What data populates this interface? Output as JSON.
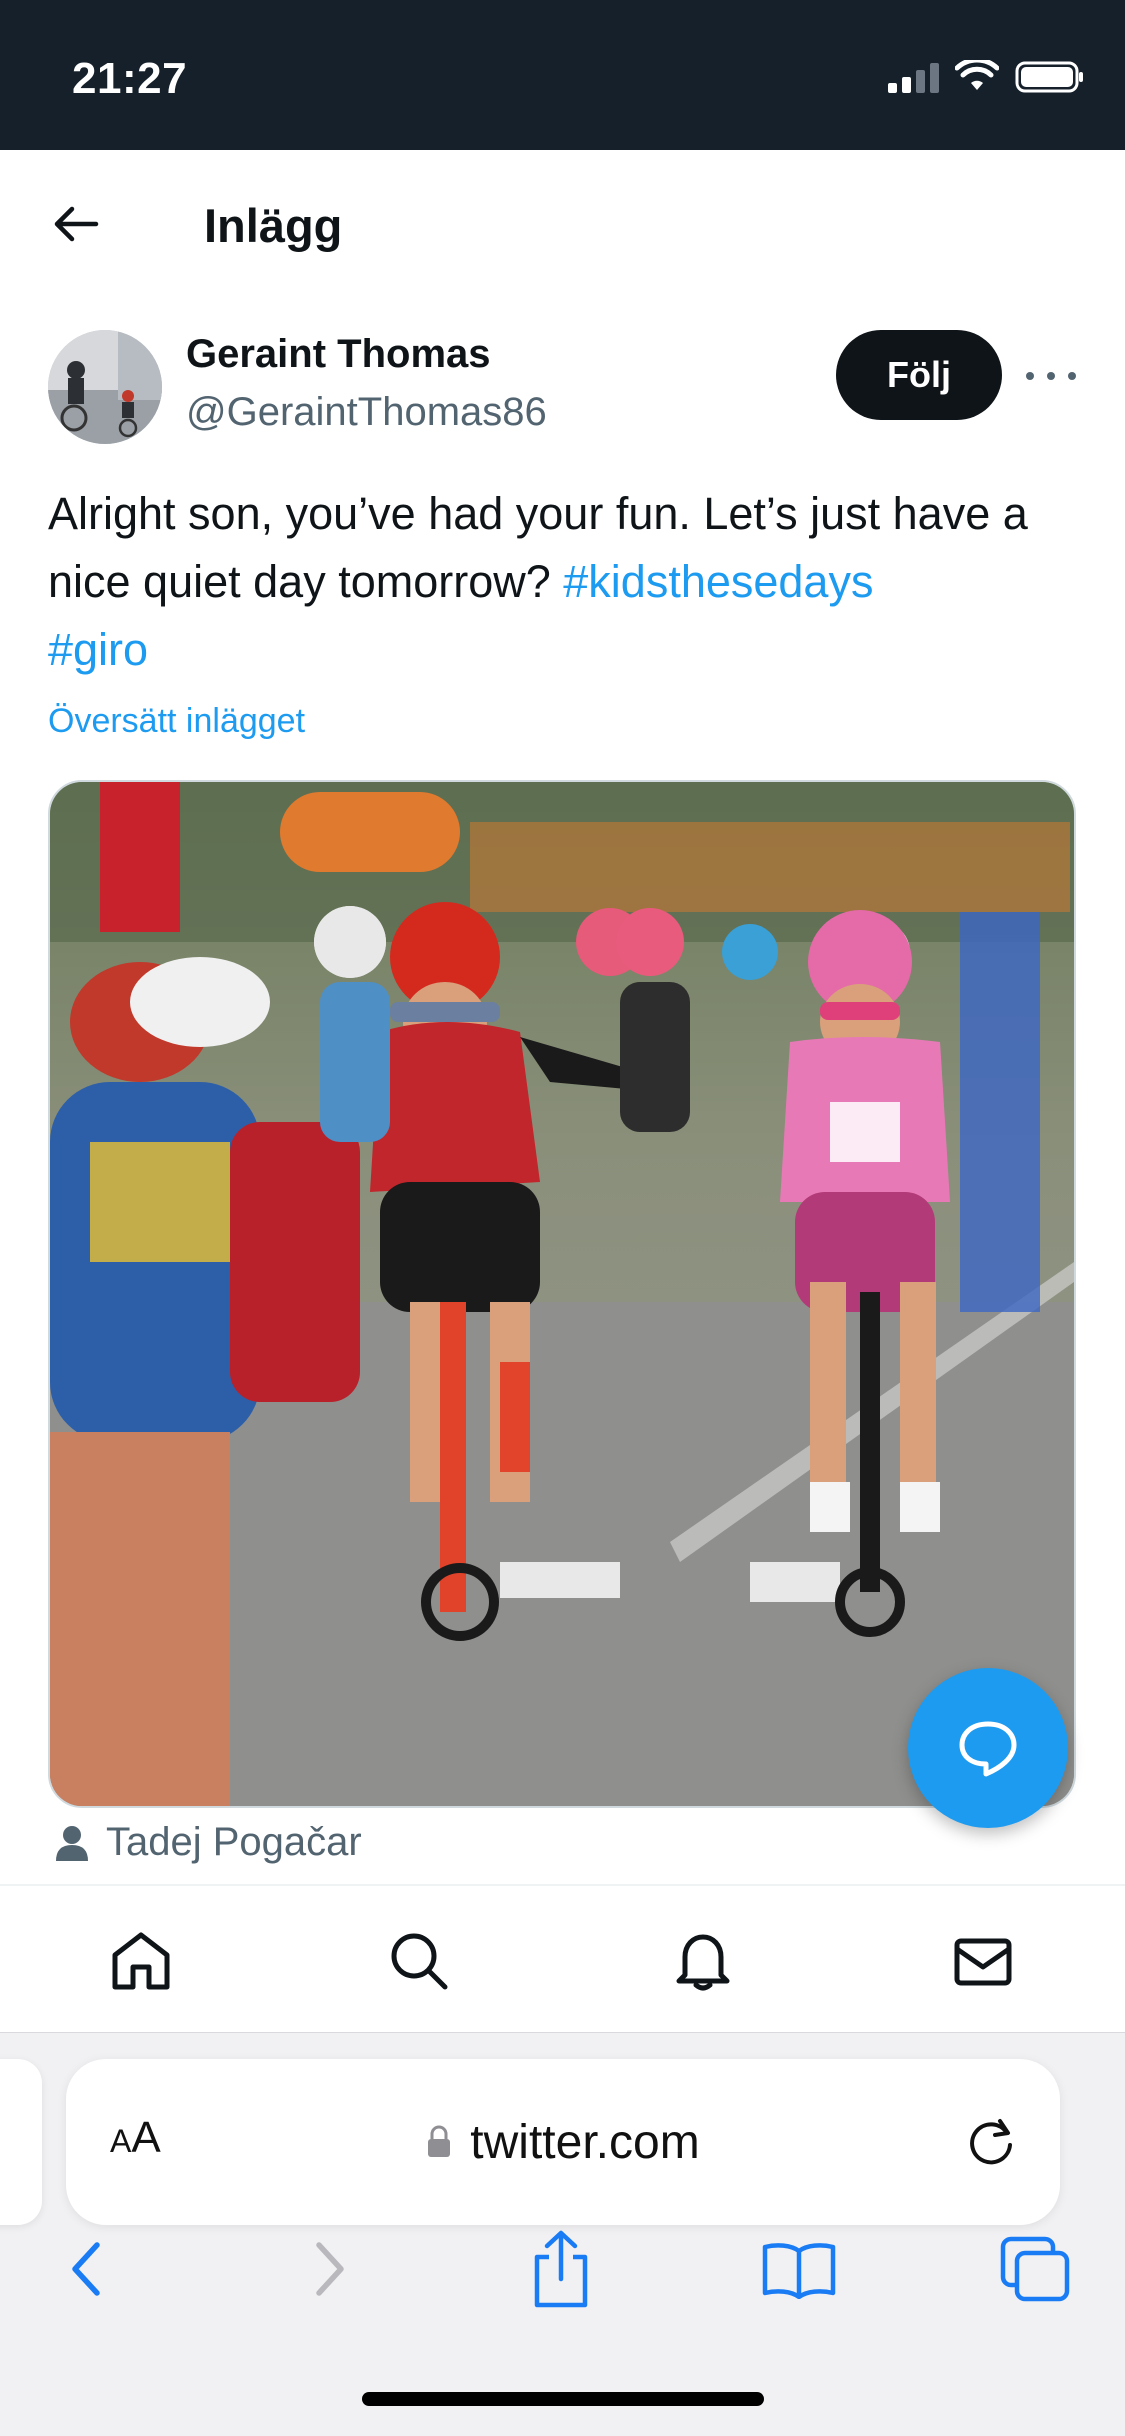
{
  "status_bar": {
    "time": "21:27"
  },
  "header": {
    "title": "Inlägg"
  },
  "author": {
    "name": "Geraint Thomas",
    "handle": "@GeraintThomas86"
  },
  "follow_button": {
    "label": "Följ"
  },
  "tweet": {
    "text": "Alright son, you’ve had your fun. Let’s just have a nice quiet day tomorrow? ",
    "hashtag1": "#kidsthesedays",
    "hashtag2": "#giro",
    "translate_label": "Översätt inlägget"
  },
  "media": {
    "tagged_user": "Tadej Pogačar"
  },
  "browser": {
    "url": "twitter.com",
    "text_size_label_small": "A",
    "text_size_label": "A"
  },
  "icons": {
    "back": "arrow-left-icon",
    "more": "more-horizontal-icon",
    "compose": "chat-bubble-icon",
    "home": "home-icon",
    "search": "search-icon",
    "notifications": "bell-icon",
    "messages": "mail-icon",
    "lock": "lock-icon",
    "reload": "reload-icon",
    "browser_back": "chevron-left-icon",
    "browser_forward": "chevron-right-icon",
    "share": "share-icon",
    "bookmarks": "book-icon",
    "tabs": "tabs-icon"
  },
  "colors": {
    "accent": "#1d9bf0",
    "status_bar_bg": "#15202b",
    "text_primary": "#0f1419",
    "text_secondary": "#536471",
    "ios_blue": "#1a7cf5"
  }
}
